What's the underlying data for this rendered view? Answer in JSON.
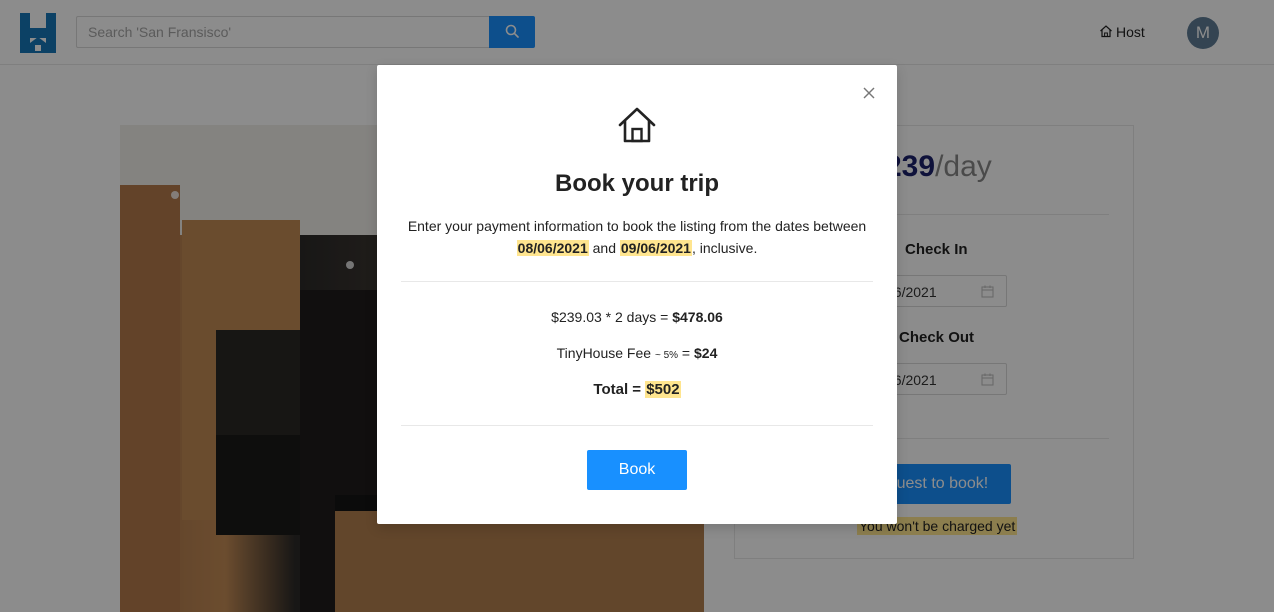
{
  "header": {
    "search": {
      "placeholder": "Search 'San Fransisco'",
      "value": ""
    },
    "host_label": "Host",
    "avatar_initial": "M"
  },
  "booking_card": {
    "price_amount": "239",
    "price_unit": "/day",
    "check_in_label": "Check In",
    "check_in_value": "06/2021",
    "check_out_label": "Check Out",
    "check_out_value": "06/2021",
    "request_button_label": "quest to book!",
    "charge_note": "You won't be charged yet"
  },
  "modal": {
    "title": "Book your trip",
    "description_prefix": "Enter your payment information to book the listing from the dates between",
    "check_in": "08/06/2021",
    "and_word": "and",
    "check_out": "09/06/2021",
    "description_suffix": ", inclusive.",
    "price_calc_expression": "$239.03 * 2 days = ",
    "price_calc_result": "$478.06",
    "fee_label": "TinyHouse Fee",
    "fee_note": "~ 5%",
    "fee_equals": " = ",
    "fee_amount": "$24",
    "total_label": "Total = ",
    "total_amount": "$502",
    "book_button_label": "Book"
  },
  "colors": {
    "primary": "#1890ff",
    "highlight": "#ffe58f",
    "price": "#1d226c",
    "logo": "#1677b9"
  },
  "icons": [
    "logo-icon",
    "search-icon",
    "home-icon",
    "close-icon",
    "calendar-icon"
  ]
}
